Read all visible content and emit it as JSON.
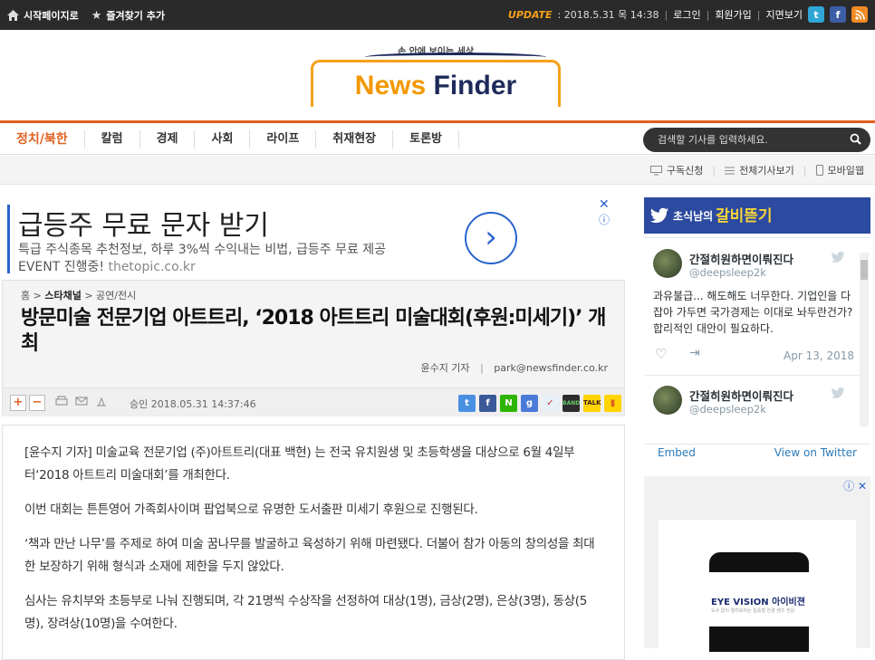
{
  "topbar": {
    "home_label": "시작페이지로",
    "bookmark_label": "즐겨찾기 추가",
    "update_label": "UPDATE",
    "update_time": ": 2018.5.31 목 14:38",
    "login": "로그인",
    "join": "회원가입",
    "paper_view": "지면보기",
    "social": {
      "twitter": "t",
      "facebook": "f",
      "rss": "rss"
    }
  },
  "header": {
    "tagline": "손 안에 보이는 세상",
    "logo_part1": "News",
    "logo_part2": "Finder"
  },
  "nav": {
    "items": [
      "정치/북한",
      "칼럼",
      "경제",
      "사회",
      "라이프",
      "취재현장",
      "토론방"
    ],
    "search_placeholder": "검색할 기사를 입력하세요."
  },
  "subbar": {
    "subscribe": "구독신청",
    "all_articles": "전체기사보기",
    "mobile": "모바일웹"
  },
  "ad": {
    "headline": "급등주 무료 문자 받기",
    "desc": "특급 주식종목 추천정보, 하루 3%씩 수익내는 비법, 급등주 무료 제공",
    "event": "EVENT 진행중!",
    "url": "thetopic.co.kr",
    "arrow": "›",
    "close": "✕",
    "info": "ⓘ"
  },
  "article": {
    "breadcrumb": {
      "home": "홈",
      "section": "스타채널",
      "sub": "공연/전시"
    },
    "title": "방문미술 전문기업 아트트리, ‘2018 아트트리 미술대회(후원:미세기)’ 개최",
    "reporter": "윤수지 기자",
    "email": "park@newsfinder.co.kr",
    "approved": "승인 2018.05.31  14:37:46",
    "font_plus": "+",
    "font_minus": "−",
    "paragraphs": [
      "[윤수지 기자] 미술교육 전문기업 (주)아트트리(대표 백현) 는 전국 유치원생 및 초등학생을 대상으로 6월 4일부터‘2018 아트트리 미술대회’를 개최한다.",
      "이번 대회는 튼튼영어 가족회사이며 팝업북으로 유명한 도서출판 미세기 후원으로 진행된다.",
      "‘책과 만난 나무’를 주제로 하여 미술 꿈나무를 발굴하고 육성하기 위해 마련됐다. 더불어 참가 아동의 창의성을 최대한 보장하기 위해 형식과 소재에 제한을 두지 않았다.",
      "심사는 유치부와 초등부로 나눠 진행되며, 각 21명씩 수상작을 선정하여 대상(1명), 금상(2명), 은상(3명), 동상(5명), 장려상(10명)을 수여한다."
    ]
  },
  "twitter": {
    "header_prefix": "초식남의",
    "header_title": "갈비뜯기",
    "tweets": [
      {
        "name": "간절히원하면이뤄진다",
        "handle": "@deepsleep2k",
        "text": "과유불급... 해도해도 너무한다. 기업인을 다 잡아 가두면 국가경제는 이대로 놔두란건가? 합리적인 대안이 필요하다.",
        "date": "Apr 13, 2018"
      },
      {
        "name": "간절히원하면이뤄진다",
        "handle": "@deepsleep2k"
      }
    ],
    "embed": "Embed",
    "view_on": "View on Twitter"
  },
  "right_ad": {
    "brand": "EYE VISION 아이비젼",
    "small": "도수 없이 멀리보이는 집중형 안경 렌즈 전문"
  }
}
